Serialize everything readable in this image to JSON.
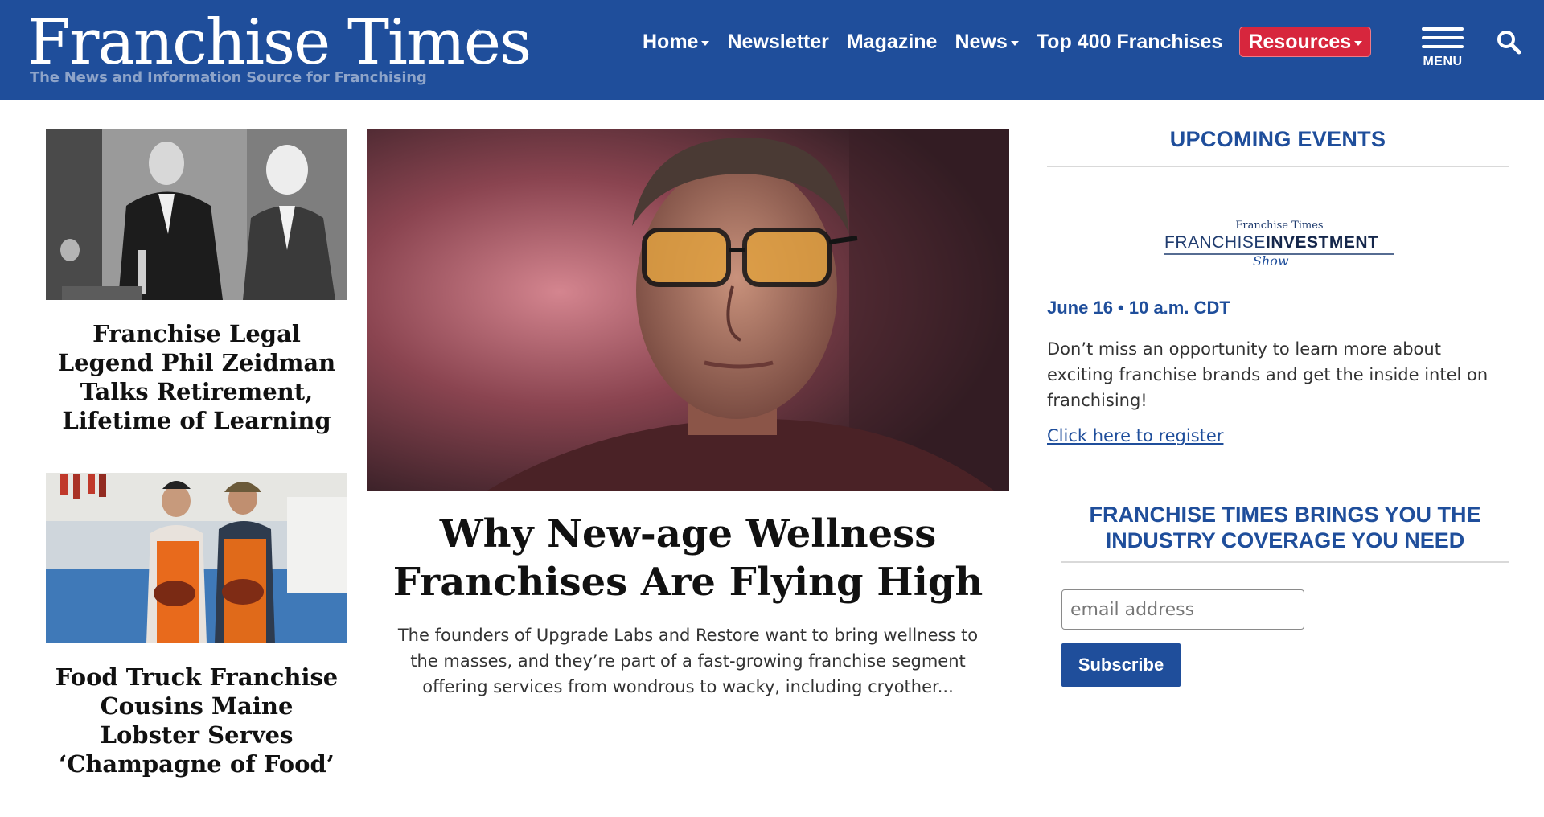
{
  "header": {
    "logo": {
      "title": "Franchise Times",
      "registered_mark": "®",
      "tagline": "The News and Information Source for Franchising"
    },
    "nav": {
      "items": [
        {
          "label": "Home",
          "dropdown": true
        },
        {
          "label": "Newsletter",
          "dropdown": false
        },
        {
          "label": "Magazine",
          "dropdown": false
        },
        {
          "label": "News",
          "dropdown": true
        },
        {
          "label": "Top 400 Franchises",
          "dropdown": false
        },
        {
          "label": "Resources",
          "dropdown": true,
          "highlight_color": "#d7263d"
        }
      ]
    },
    "menu_label": "MENU",
    "search_icon": "search-icon",
    "background_color": "#1f4e9b"
  },
  "left_column": {
    "articles": [
      {
        "title": "Franchise Legal Legend Phil Zeidman Talks Retirement, Lifetime of Learning",
        "image": "black-and-white-photo-of-men-in-suits-at-podium"
      },
      {
        "title": "Food Truck Franchise Cousins Maine Lobster Serves ‘Champagne of Food’",
        "image": "photo-of-two-men-in-orange-overalls-holding-lobsters"
      }
    ]
  },
  "feature": {
    "title": "Why New-age Wellness Franchises Are Flying High",
    "excerpt": "The founders of Upgrade Labs and Restore want to bring wellness to the masses, and they’re part of a fast-growing franchise segment offering services from wondrous to wacky, including cryother...",
    "image": "portrait-of-man-with-amber-glasses-in-pink-mist"
  },
  "sidebar": {
    "events_heading": "UPCOMING EVENTS",
    "event": {
      "logo_top": "Franchise Times",
      "logo_left": "FRANCHISE",
      "logo_right": "INVESTMENT",
      "logo_script": "Show",
      "date": "June 16 • 10 a.m. CDT",
      "description": "Don’t miss an opportunity to learn more about exciting franchise brands and get the inside intel on franchising!",
      "link_text": "Click here to register"
    },
    "promo_heading": "FRANCHISE TIMES BRINGS YOU THE INDUSTRY COVERAGE YOU NEED",
    "email_placeholder": "email address",
    "subscribe_label": "Subscribe"
  },
  "colors": {
    "brand_blue": "#1f4e9b",
    "resources_red": "#d7263d",
    "tagline_gray_blue": "#8ea4c9"
  }
}
